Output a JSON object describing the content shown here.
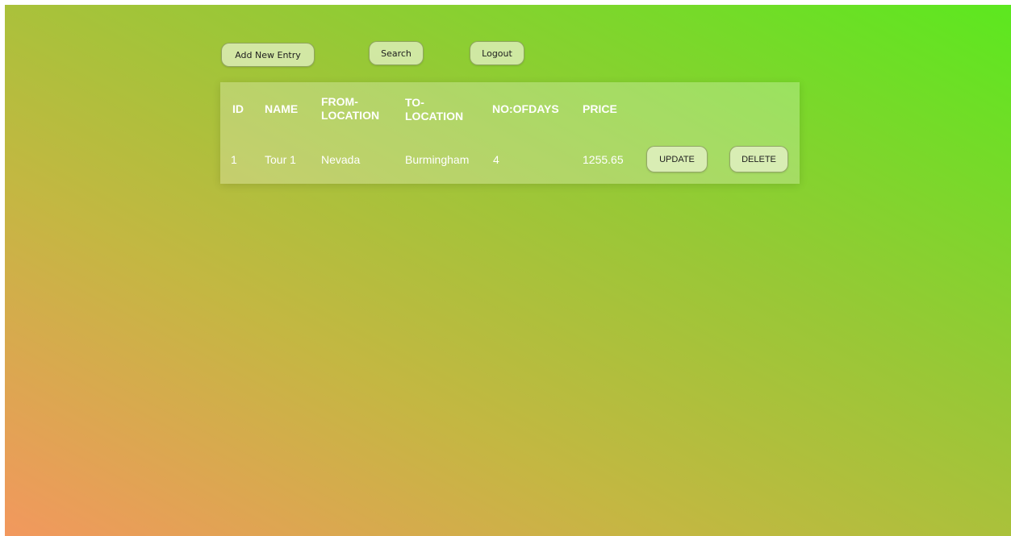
{
  "toolbar": {
    "add_label": "Add New Entry",
    "search_label": "Search",
    "logout_label": "Logout"
  },
  "table": {
    "headers": {
      "id": "ID",
      "name": "NAME",
      "from_line1": "FROM-",
      "from_line2": "LOCATION",
      "to_line1": "TO-",
      "to_line2": "LOCATION",
      "days": "NO:OFDAYS",
      "price": "PRICE"
    },
    "rows": [
      {
        "id": "1",
        "name": "Tour 1",
        "from": "Nevada",
        "to": "Burmingham",
        "days": "4",
        "price": "1255.65",
        "update_label": "UPDATE",
        "delete_label": "DELETE"
      }
    ]
  },
  "colors": {
    "gradient_bottom_left": "#f2985e",
    "gradient_top_right": "#5ce81f",
    "button_fill": "#deeebc",
    "text_light": "#ffffff"
  }
}
